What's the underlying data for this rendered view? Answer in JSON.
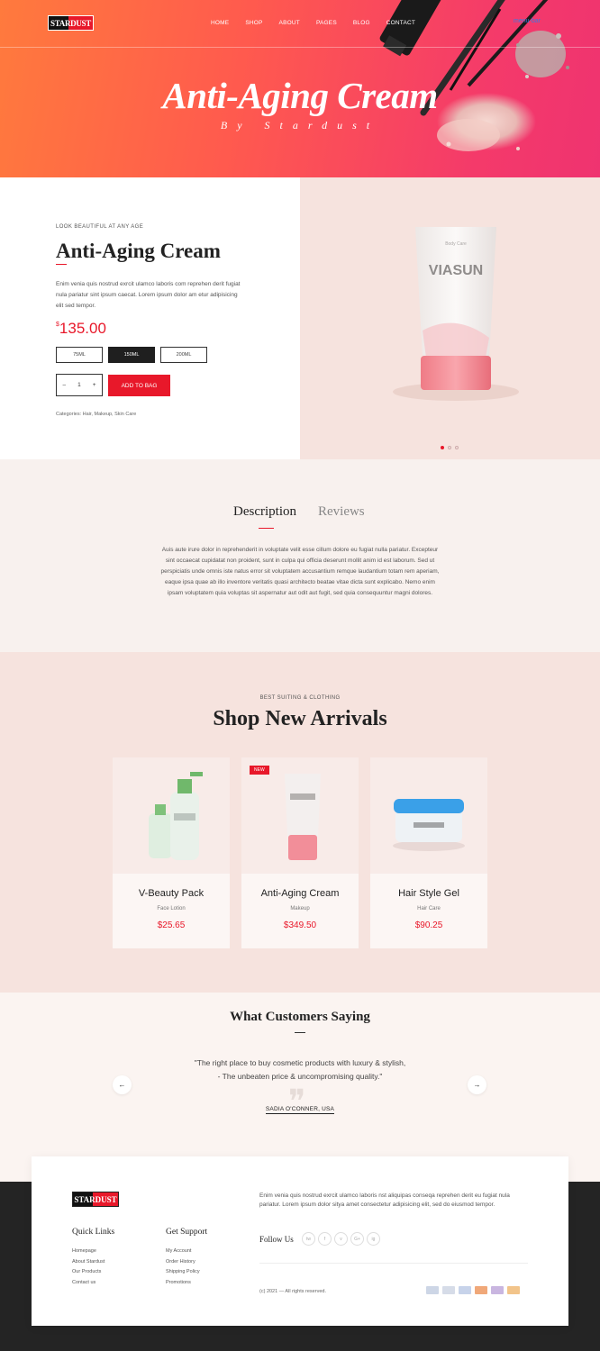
{
  "brand": {
    "logo_text": "STARDUST",
    "accent": "#e8182a"
  },
  "nav": {
    "items": [
      "HOME",
      "SHOP",
      "ABOUT",
      "PAGES",
      "BLOG",
      "CONTACT"
    ],
    "menu_icon_alt": "menu-bar"
  },
  "hero": {
    "title": "Anti-Aging Cream",
    "subtitle": "By Stardust"
  },
  "product": {
    "eyebrow": "LOOK BEAUTIFUL AT ANY AGE",
    "title": "Anti-Aging Cream",
    "description": "Enim venia quis nostrud exrcit ulamco laboris com reprehen derit fugiat nula pariatur sint ipsum caecat. Lorem ipsum dolor am etur adipisicing elit sed tempor.",
    "currency": "$",
    "price": "135.00",
    "sizes": [
      "75ML",
      "150ML",
      "200ML"
    ],
    "selected_size": "150ML",
    "quantity": "1",
    "qty_minus": "–",
    "qty_plus": "+",
    "add_to_bag": "ADD TO BAG",
    "categories": "Categories: Hair, Makeup, Skin Care",
    "image_brand": "VIASUN",
    "image_small": "Body Care",
    "slider_dots": 3,
    "active_dot": 0
  },
  "details": {
    "tabs": [
      "Description",
      "Reviews"
    ],
    "active_tab": "Description",
    "text": "Auis aute irure dolor in reprehenderit in voluptate velit esse cillum dolore eu fugiat nulla pariatur. Excepteur sint occaecat cupidatat non proident, sunt in culpa qui officia deserunt mollit anim id est laborum. Sed ut perspiciatis unde omnis iste natus error sit voluptatem accusantium remque laudantium totam rem aperiam, eaque ipsa quae ab illo inventore veritatis quasi architecto beatae vitae dicta sunt explicabo. Nemo enim ipsam voluptatem quia voluptas sit aspernatur aut odit aut fugit, sed quia consequuntur magni dolores."
  },
  "shop": {
    "eyebrow": "BEST SUITING & CLOTHING",
    "title": "Shop New Arrivals",
    "products": [
      {
        "name": "V-Beauty Pack",
        "category": "Face Lotion",
        "price": "$25.65",
        "badge": ""
      },
      {
        "name": "Anti-Aging Cream",
        "category": "Makeup",
        "price": "$349.50",
        "badge": "NEW"
      },
      {
        "name": "Hair Style Gel",
        "category": "Hair Care",
        "price": "$90.25",
        "badge": ""
      }
    ]
  },
  "testimonial": {
    "title": "What Customers Saying",
    "quote_line1": "\"The right place to buy cosmetic products with luxury & stylish,",
    "quote_line2": "- The unbeaten price & uncompromising quality.\"",
    "author": "SADIA O'CONNER, USA",
    "prev": "←",
    "next": "→"
  },
  "footer": {
    "quick_links_title": "Quick Links",
    "quick_links": [
      "Homepage",
      "About Stardust",
      "Our Products",
      "Contact us"
    ],
    "support_title": "Get Support",
    "support_links": [
      "My Account",
      "Order History",
      "Shipping Policy",
      "Promotions"
    ],
    "description": "Enim venia quis nostrud exrcit ulamco laboris nst aliquipas conseqa reprehen derit eu fugiat nula pariatur. Lorem ipsum dolor sitya amet consectetur adipisicing elit, sed do eiusmod tempor.",
    "follow_label": "Follow Us",
    "socials": [
      "tw",
      "f",
      "v",
      "G+",
      "ig"
    ],
    "copyright": "(c) 2021 — All rights reserved.",
    "payment_colors": [
      "#cdd6e6",
      "#d6dce8",
      "#c7d3ea",
      "#f0a879",
      "#c9b6e0",
      "#f2c48a"
    ]
  }
}
